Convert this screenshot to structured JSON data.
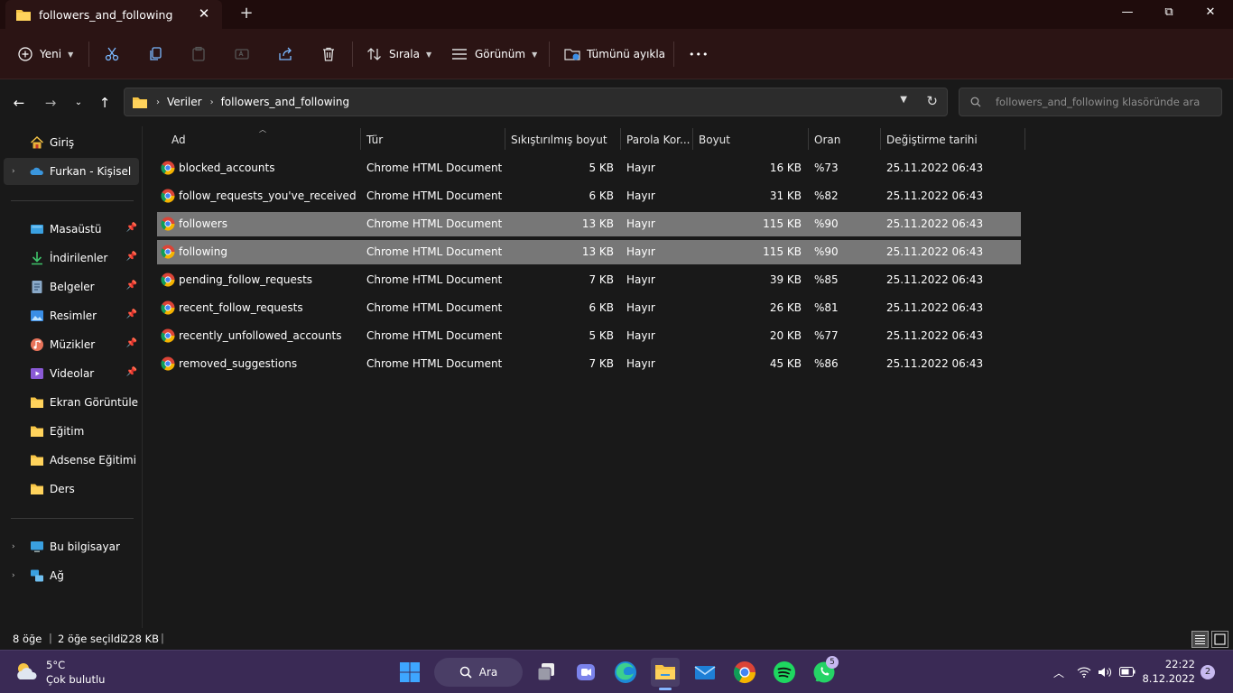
{
  "window": {
    "tab_title": "followers_and_following",
    "minimize": "—",
    "restore": "⧉",
    "close": "✕"
  },
  "toolbar": {
    "new_label": "Yeni",
    "sort_label": "Sırala",
    "view_label": "Görünüm",
    "extract_label": "Tümünü ayıkla",
    "more": "•••"
  },
  "address": {
    "breadcrumbs": [
      "Veriler",
      "followers_and_following"
    ],
    "search_placeholder": "followers_and_following klasöründe ara"
  },
  "sidebar": {
    "items": [
      {
        "label": "Giriş",
        "icon": "home-icon"
      },
      {
        "label": "Furkan - Kişisel",
        "icon": "onedrive-icon"
      },
      {
        "label": "Masaüstü",
        "icon": "desktop-icon"
      },
      {
        "label": "İndirilenler",
        "icon": "download-icon"
      },
      {
        "label": "Belgeler",
        "icon": "documents-icon"
      },
      {
        "label": "Resimler",
        "icon": "pictures-icon"
      },
      {
        "label": "Müzikler",
        "icon": "music-icon"
      },
      {
        "label": "Videolar",
        "icon": "videos-icon"
      },
      {
        "label": "Ekran Görüntüleri",
        "icon": "folder-icon"
      },
      {
        "label": "Eğitim",
        "icon": "folder-icon"
      },
      {
        "label": "Adsense Eğitimi Ge",
        "icon": "folder-icon"
      },
      {
        "label": "Ders",
        "icon": "folder-icon"
      },
      {
        "label": "Bu bilgisayar",
        "icon": "computer-icon"
      },
      {
        "label": "Ağ",
        "icon": "network-icon"
      }
    ]
  },
  "columns": [
    "Ad",
    "Tür",
    "Sıkıştırılmış boyut",
    "Parola Kor...",
    "Boyut",
    "Oran",
    "Değiştirme tarihi"
  ],
  "files": [
    {
      "name": "blocked_accounts",
      "type": "Chrome HTML Document",
      "compressed": "5 KB",
      "password": "Hayır",
      "size": "16 KB",
      "ratio": "%73",
      "modified": "25.11.2022 06:43"
    },
    {
      "name": "follow_requests_you've_received",
      "type": "Chrome HTML Document",
      "compressed": "6 KB",
      "password": "Hayır",
      "size": "31 KB",
      "ratio": "%82",
      "modified": "25.11.2022 06:43"
    },
    {
      "name": "followers",
      "type": "Chrome HTML Document",
      "compressed": "13 KB",
      "password": "Hayır",
      "size": "115 KB",
      "ratio": "%90",
      "modified": "25.11.2022 06:43"
    },
    {
      "name": "following",
      "type": "Chrome HTML Document",
      "compressed": "13 KB",
      "password": "Hayır",
      "size": "115 KB",
      "ratio": "%90",
      "modified": "25.11.2022 06:43"
    },
    {
      "name": "pending_follow_requests",
      "type": "Chrome HTML Document",
      "compressed": "7 KB",
      "password": "Hayır",
      "size": "39 KB",
      "ratio": "%85",
      "modified": "25.11.2022 06:43"
    },
    {
      "name": "recent_follow_requests",
      "type": "Chrome HTML Document",
      "compressed": "6 KB",
      "password": "Hayır",
      "size": "26 KB",
      "ratio": "%81",
      "modified": "25.11.2022 06:43"
    },
    {
      "name": "recently_unfollowed_accounts",
      "type": "Chrome HTML Document",
      "compressed": "5 KB",
      "password": "Hayır",
      "size": "20 KB",
      "ratio": "%77",
      "modified": "25.11.2022 06:43"
    },
    {
      "name": "removed_suggestions",
      "type": "Chrome HTML Document",
      "compressed": "7 KB",
      "password": "Hayır",
      "size": "45 KB",
      "ratio": "%86",
      "modified": "25.11.2022 06:43"
    }
  ],
  "status": {
    "item_count": "8 öğe",
    "selection": "2 öğe seçildi",
    "selection_size": "228 KB"
  },
  "taskbar": {
    "weather_temp": "5°C",
    "weather_desc": "Çok bulutlu",
    "search_label": "Ara",
    "whatsapp_badge": "5",
    "time": "22:22",
    "date": "8.12.2022",
    "notification_count": "2"
  },
  "colors": {
    "titlebar": "#1f0c0c",
    "commandbar": "#2b1414",
    "selection": "#777777",
    "taskbar": "#3a2a55",
    "folder": "#f6c445"
  }
}
